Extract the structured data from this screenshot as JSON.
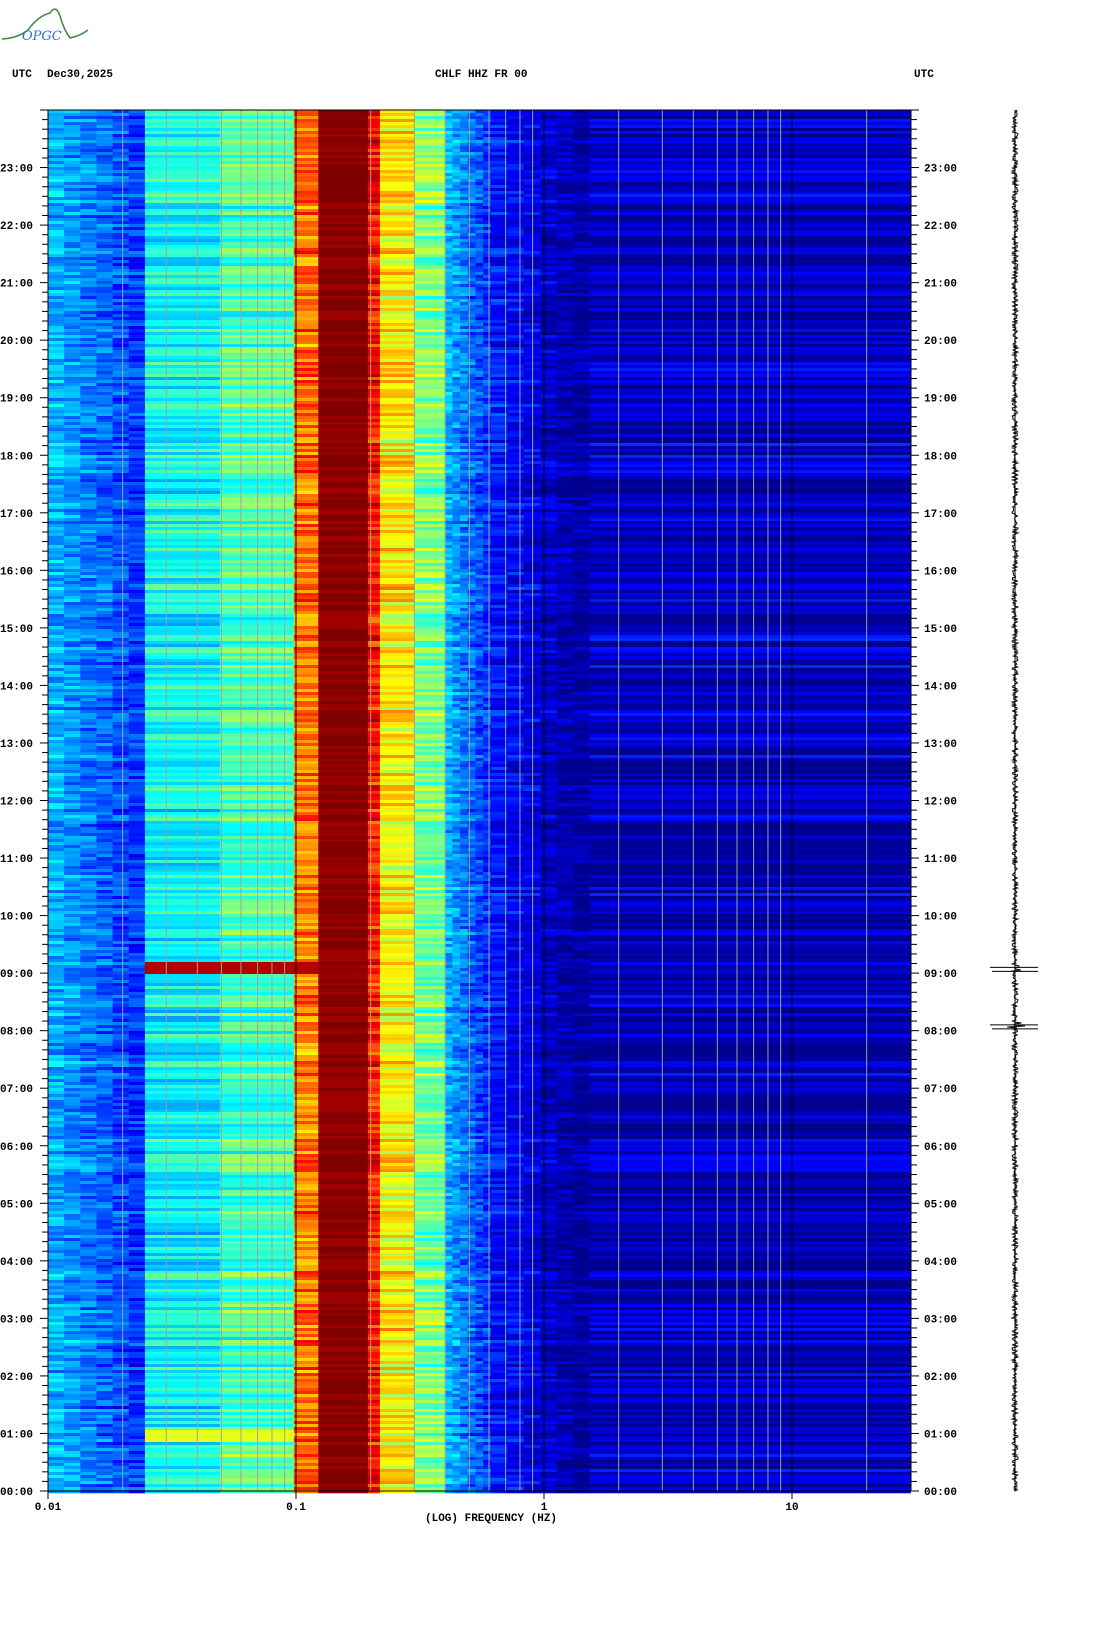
{
  "header": {
    "logo_text": "OPGC",
    "left_timezone": "UTC",
    "date": "Dec30,2025",
    "station_title": "CHLF HHZ FR 00",
    "right_timezone": "UTC"
  },
  "chart_data": {
    "type": "heatmap",
    "title": "CHLF HHZ FR 00",
    "xlabel": "(LOG) FREQUENCY (HZ)",
    "xscale": "log",
    "xlim": [
      0.01,
      30
    ],
    "x_tick_labels": [
      "0.01",
      "0.1",
      "1",
      "10"
    ],
    "x_tick_values": [
      0.01,
      0.1,
      1,
      10
    ],
    "ylabel": "UTC",
    "ylim_hours": [
      0,
      24
    ],
    "y_tick_labels": [
      "00:00",
      "01:00",
      "02:00",
      "03:00",
      "04:00",
      "05:00",
      "06:00",
      "07:00",
      "08:00",
      "09:00",
      "10:00",
      "11:00",
      "12:00",
      "13:00",
      "14:00",
      "15:00",
      "16:00",
      "17:00",
      "18:00",
      "19:00",
      "20:00",
      "21:00",
      "22:00",
      "23:00"
    ],
    "y_minor_tick_minutes": 10,
    "colormap": [
      "#00008f",
      "#0000ff",
      "#0080ff",
      "#00ffff",
      "#80ff80",
      "#ffff00",
      "#ff8000",
      "#ff0000",
      "#800000"
    ],
    "frequency_bands": [
      {
        "f_min": 0.01,
        "f_max": 0.0246,
        "level": 0.3
      },
      {
        "f_min": 0.0246,
        "f_max": 0.0493,
        "level": 0.38
      },
      {
        "f_min": 0.0493,
        "f_max": 0.098,
        "level": 0.45
      },
      {
        "f_min": 0.098,
        "f_max": 0.123,
        "level": 0.76
      },
      {
        "f_min": 0.123,
        "f_max": 0.195,
        "level": 1.0
      },
      {
        "f_min": 0.195,
        "f_max": 0.218,
        "level": 0.86
      },
      {
        "f_min": 0.218,
        "f_max": 0.302,
        "level": 0.64
      },
      {
        "f_min": 0.302,
        "f_max": 0.398,
        "level": 0.5
      },
      {
        "f_min": 0.398,
        "f_max": 0.61,
        "level": 0.3
      },
      {
        "f_min": 0.61,
        "f_max": 1.53,
        "level": 0.14
      },
      {
        "f_min": 1.53,
        "f_max": 30,
        "level": 0.05
      }
    ],
    "events": [
      {
        "time_hours": 9.13,
        "f_max": 0.123,
        "level": 0.95
      },
      {
        "time_hours": 1.0,
        "f_max": 0.098,
        "level": 0.6
      }
    ],
    "grid_lines_hz": [
      0.02,
      0.03,
      0.04,
      0.05,
      0.06,
      0.07,
      0.08,
      0.09,
      0.2,
      0.3,
      0.4,
      0.5,
      0.6,
      0.7,
      0.8,
      0.9,
      2,
      3,
      4,
      5,
      6,
      7,
      8,
      9,
      20
    ],
    "decade_lines_hz": [
      0.1,
      1,
      10
    ],
    "trace_spikes_hours": [
      9.1,
      8.1
    ]
  }
}
